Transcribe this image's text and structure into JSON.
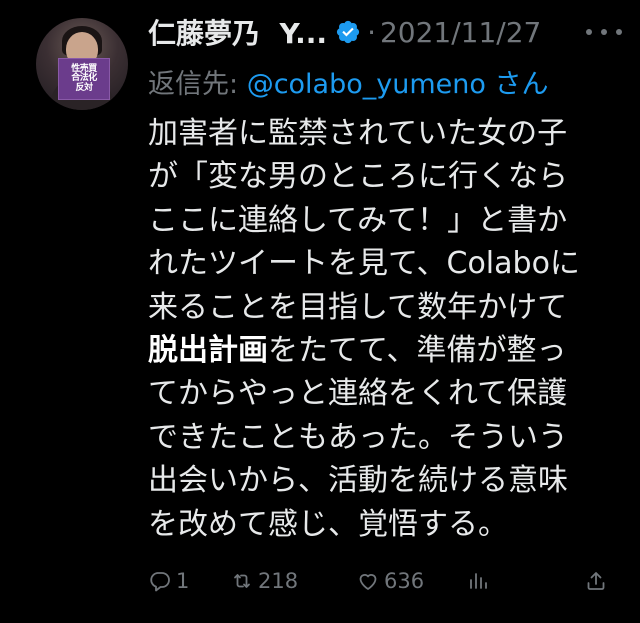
{
  "tweet": {
    "author_name": "仁藤夢乃",
    "author_suffix": "Y...",
    "dot": "·",
    "date": "2021/11/27",
    "reply_prefix": "返信先: ",
    "reply_handle": "@colabo_yumeno",
    "reply_suffix": " さん",
    "avatar_sign": {
      "line1": "性売買",
      "line2": "合法化",
      "line3": "反対"
    },
    "body_lines": [
      {
        "pre": "加害者に監禁されていた女の子",
        "bold": "",
        "post": ""
      },
      {
        "pre": "が「変な男のところに行くなら",
        "bold": "",
        "post": ""
      },
      {
        "pre": "ここに連絡してみて！」と書か",
        "bold": "",
        "post": ""
      },
      {
        "pre": "れたツイートを見て、Colaboに",
        "bold": "",
        "post": ""
      },
      {
        "pre": "来ることを目指して数年かけて",
        "bold": "",
        "post": ""
      },
      {
        "pre": "",
        "bold": "脱出計画",
        "post": "をたてて、準備が整っ"
      },
      {
        "pre": "てからやっと連絡をくれて保護",
        "bold": "",
        "post": ""
      },
      {
        "pre": "できたこともあった。そういう",
        "bold": "",
        "post": ""
      },
      {
        "pre": "出会いから、活動を続ける意味",
        "bold": "",
        "post": ""
      },
      {
        "pre": "を改めて感じ、覚悟する。",
        "bold": "",
        "post": ""
      }
    ],
    "stats": {
      "replies": "1",
      "retweets": "218",
      "likes": "636"
    }
  },
  "colors": {
    "background": "#000000",
    "text": "#e7e9ea",
    "muted": "#71767b",
    "accent": "#1d9bf0"
  },
  "icons": {
    "verified": "verified-badge-icon",
    "more": "more-options-icon",
    "reply": "reply-icon",
    "retweet": "retweet-icon",
    "like": "heart-icon",
    "views": "views-chart-icon",
    "share": "share-icon"
  }
}
